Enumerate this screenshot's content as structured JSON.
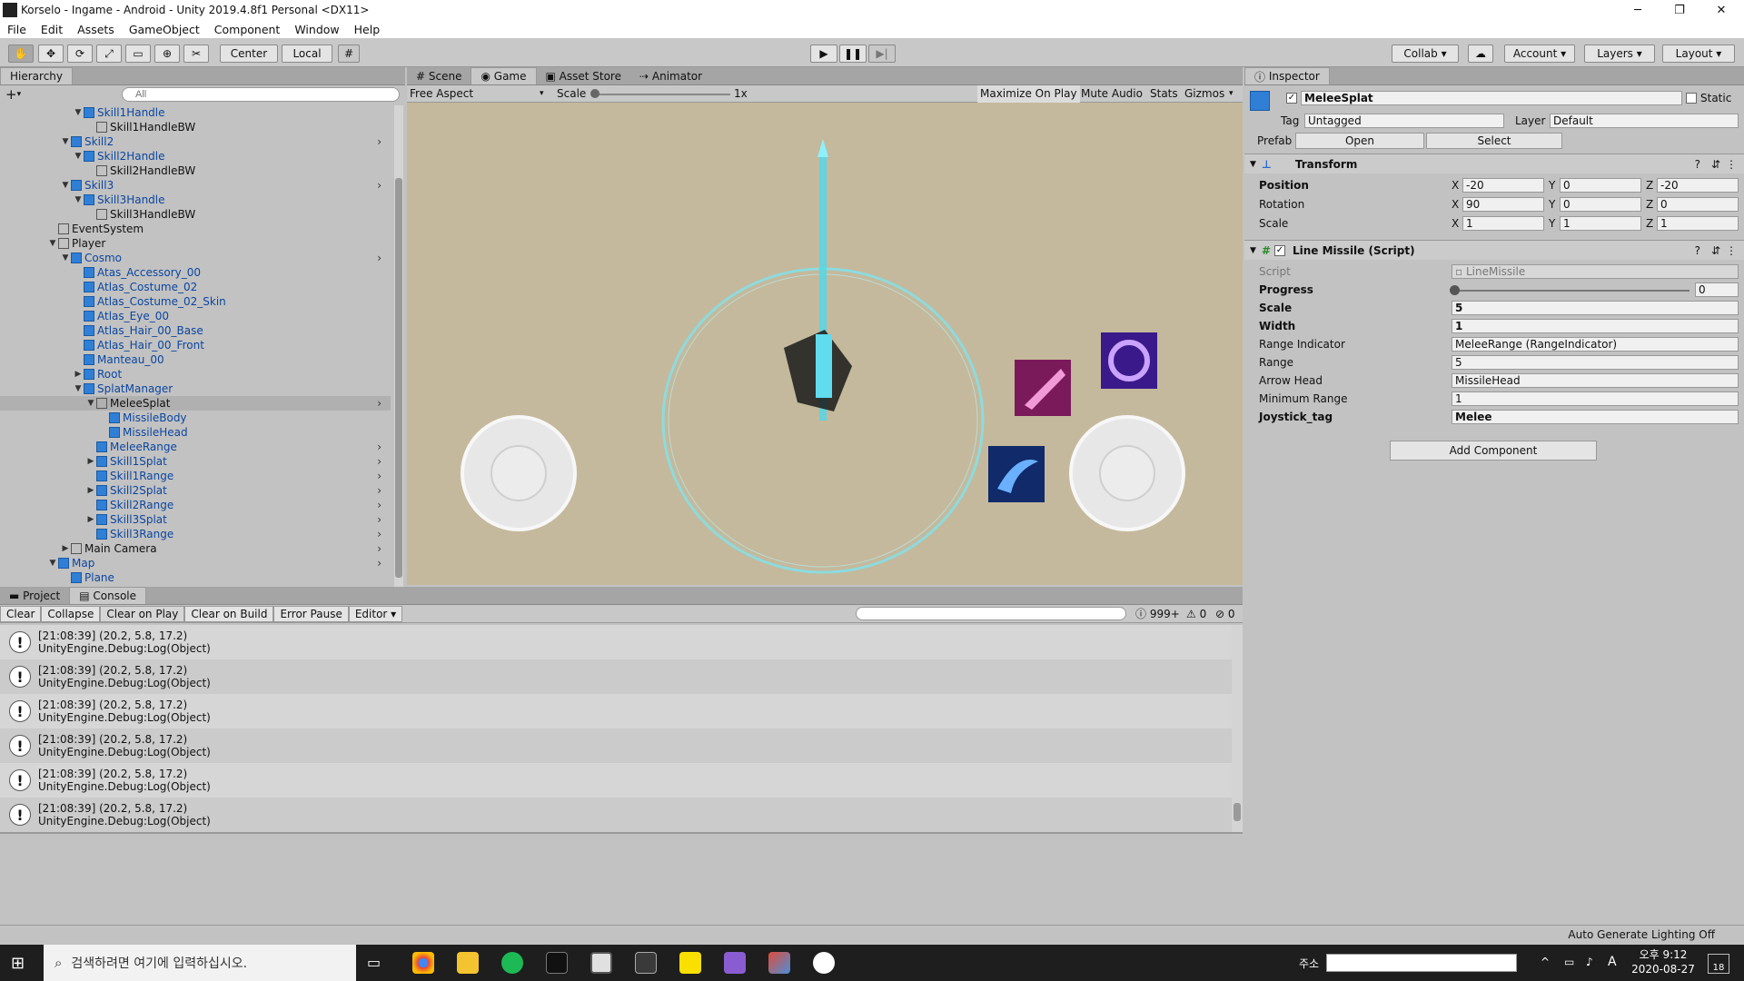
{
  "window": {
    "title": "Korselo - Ingame - Android - Unity 2019.4.8f1 Personal <DX11>",
    "min": "─",
    "max": "❐",
    "close": "✕"
  },
  "menu": [
    "File",
    "Edit",
    "Assets",
    "GameObject",
    "Component",
    "Window",
    "Help"
  ],
  "toolbar": {
    "center": "Center",
    "local": "Local",
    "collab": "Collab",
    "account": "Account",
    "layers": "Layers",
    "layout": "Layout"
  },
  "hierarchy": {
    "tab": "Hierarchy",
    "search_placeholder": "All",
    "add": "+",
    "items": [
      {
        "label": "Skill1Handle",
        "depth": 2,
        "arrow": "▼",
        "blue": true
      },
      {
        "label": "Skill1HandleBW",
        "depth": 3,
        "arrow": "",
        "blue": false
      },
      {
        "label": "Skill2",
        "depth": 1,
        "arrow": "▼",
        "blue": true,
        "chev": true
      },
      {
        "label": "Skill2Handle",
        "depth": 2,
        "arrow": "▼",
        "blue": true
      },
      {
        "label": "Skill2HandleBW",
        "depth": 3,
        "arrow": "",
        "blue": false
      },
      {
        "label": "Skill3",
        "depth": 1,
        "arrow": "▼",
        "blue": true,
        "chev": true
      },
      {
        "label": "Skill3Handle",
        "depth": 2,
        "arrow": "▼",
        "blue": true
      },
      {
        "label": "Skill3HandleBW",
        "depth": 3,
        "arrow": "",
        "blue": false
      },
      {
        "label": "EventSystem",
        "depth": 0,
        "arrow": "",
        "blue": false
      },
      {
        "label": "Player",
        "depth": 0,
        "arrow": "▼",
        "blue": false
      },
      {
        "label": "Cosmo",
        "depth": 1,
        "arrow": "▼",
        "blue": true,
        "chev": true
      },
      {
        "label": "Atas_Accessory_00",
        "depth": 2,
        "arrow": "",
        "blue": true
      },
      {
        "label": "Atlas_Costume_02",
        "depth": 2,
        "arrow": "",
        "blue": true
      },
      {
        "label": "Atlas_Costume_02_Skin",
        "depth": 2,
        "arrow": "",
        "blue": true
      },
      {
        "label": "Atlas_Eye_00",
        "depth": 2,
        "arrow": "",
        "blue": true
      },
      {
        "label": "Atlas_Hair_00_Base",
        "depth": 2,
        "arrow": "",
        "blue": true
      },
      {
        "label": "Atlas_Hair_00_Front",
        "depth": 2,
        "arrow": "",
        "blue": true
      },
      {
        "label": "Manteau_00",
        "depth": 2,
        "arrow": "",
        "blue": true
      },
      {
        "label": "Root",
        "depth": 2,
        "arrow": "▶",
        "blue": true
      },
      {
        "label": "SplatManager",
        "depth": 2,
        "arrow": "▼",
        "blue": true
      },
      {
        "label": "MeleeSplat",
        "depth": 3,
        "arrow": "▼",
        "blue": false,
        "chev": true,
        "selected": true
      },
      {
        "label": "MissileBody",
        "depth": 4,
        "arrow": "",
        "blue": true
      },
      {
        "label": "MissileHead",
        "depth": 4,
        "arrow": "",
        "blue": true
      },
      {
        "label": "MeleeRange",
        "depth": 3,
        "arrow": "",
        "blue": true,
        "chev": true
      },
      {
        "label": "Skill1Splat",
        "depth": 3,
        "arrow": "▶",
        "blue": true,
        "chev": true
      },
      {
        "label": "Skill1Range",
        "depth": 3,
        "arrow": "",
        "blue": true,
        "chev": true
      },
      {
        "label": "Skill2Splat",
        "depth": 3,
        "arrow": "▶",
        "blue": true,
        "chev": true
      },
      {
        "label": "Skill2Range",
        "depth": 3,
        "arrow": "",
        "blue": true,
        "chev": true
      },
      {
        "label": "Skill3Splat",
        "depth": 3,
        "arrow": "▶",
        "blue": true,
        "chev": true
      },
      {
        "label": "Skill3Range",
        "depth": 3,
        "arrow": "",
        "blue": true,
        "chev": true
      },
      {
        "label": "Main Camera",
        "depth": 1,
        "arrow": "▶",
        "blue": false,
        "chev": true
      },
      {
        "label": "Map",
        "depth": 0,
        "arrow": "▼",
        "blue": true,
        "chev": true
      },
      {
        "label": "Plane",
        "depth": 1,
        "arrow": "",
        "blue": true
      }
    ]
  },
  "game": {
    "tabs": [
      "Scene",
      "Game",
      "Asset Store",
      "Animator"
    ],
    "aspect": "Free Aspect",
    "scale_label": "Scale",
    "scale_value": "1x",
    "maximize": "Maximize On Play",
    "mute": "Mute Audio",
    "stats": "Stats",
    "gizmos": "Gizmos"
  },
  "console": {
    "tabs": [
      "Project",
      "Console"
    ],
    "buttons": [
      "Clear",
      "Collapse",
      "Clear on Play",
      "Clear on Build",
      "Error Pause",
      "Editor"
    ],
    "counts": {
      "log": "999+",
      "warn": "0",
      "error": "0"
    },
    "logs": [
      {
        "line1": "[21:08:39] (20.2, 5.8, 17.2)",
        "line2": "UnityEngine.Debug:Log(Object)"
      },
      {
        "line1": "[21:08:39] (20.2, 5.8, 17.2)",
        "line2": "UnityEngine.Debug:Log(Object)"
      },
      {
        "line1": "[21:08:39] (20.2, 5.8, 17.2)",
        "line2": "UnityEngine.Debug:Log(Object)"
      },
      {
        "line1": "[21:08:39] (20.2, 5.8, 17.2)",
        "line2": "UnityEngine.Debug:Log(Object)"
      },
      {
        "line1": "[21:08:39] (20.2, 5.8, 17.2)",
        "line2": "UnityEngine.Debug:Log(Object)"
      },
      {
        "line1": "[21:08:39] (20.2, 5.8, 17.2)",
        "line2": "UnityEngine.Debug:Log(Object)"
      }
    ]
  },
  "inspector": {
    "tab": "Inspector",
    "object_name": "MeleeSplat",
    "static": "Static",
    "tag_label": "Tag",
    "tag_value": "Untagged",
    "layer_label": "Layer",
    "layer_value": "Default",
    "prefab_label": "Prefab",
    "open": "Open",
    "select": "Select",
    "transform": {
      "title": "Transform",
      "rows": [
        {
          "label": "Position",
          "x": "-20",
          "y": "0",
          "z": "-20"
        },
        {
          "label": "Rotation",
          "x": "90",
          "y": "0",
          "z": "0"
        },
        {
          "label": "Scale",
          "x": "1",
          "y": "1",
          "z": "1"
        }
      ]
    },
    "script": {
      "title": "Line Missile (Script)",
      "script_label": "Script",
      "script_value": "LineMissile",
      "progress_label": "Progress",
      "progress_value": "0",
      "fields": [
        {
          "label": "Scale",
          "value": "5",
          "bold": true
        },
        {
          "label": "Width",
          "value": "1",
          "bold": true
        },
        {
          "label": "Range Indicator",
          "value": "MeleeRange (RangeIndicator)",
          "bold": false
        },
        {
          "label": "Range",
          "value": "5",
          "bold": false
        },
        {
          "label": "Arrow Head",
          "value": "MissileHead",
          "bold": false
        },
        {
          "label": "Minimum Range",
          "value": "1",
          "bold": false
        },
        {
          "label": "Joystick_tag",
          "value": "Melee",
          "bold": true
        }
      ]
    },
    "add_component": "Add Component"
  },
  "status": "Auto Generate Lighting Off",
  "taskbar": {
    "search": "검색하려면 여기에 입력하십시오.",
    "address": "주소",
    "time": "오후 9:12",
    "date": "2020-08-27",
    "notif": "18",
    "ime": "A"
  }
}
